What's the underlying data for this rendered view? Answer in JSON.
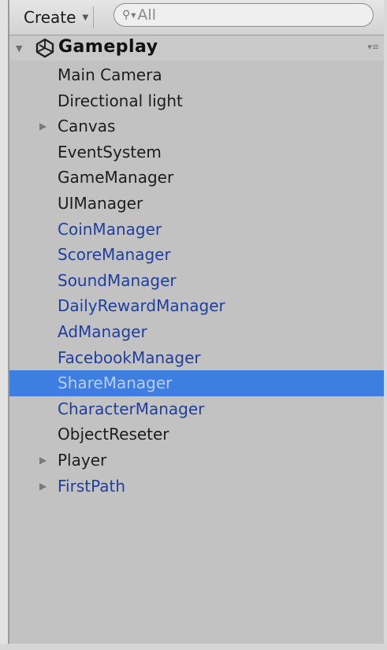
{
  "toolbar": {
    "create_label": "Create",
    "search_placeholder": "All"
  },
  "scene": {
    "name": "Gameplay"
  },
  "hierarchy": [
    {
      "label": "Main Camera",
      "prefab": false,
      "expandable": false,
      "selected": false
    },
    {
      "label": "Directional light",
      "prefab": false,
      "expandable": false,
      "selected": false
    },
    {
      "label": "Canvas",
      "prefab": false,
      "expandable": true,
      "selected": false
    },
    {
      "label": "EventSystem",
      "prefab": false,
      "expandable": false,
      "selected": false
    },
    {
      "label": "GameManager",
      "prefab": false,
      "expandable": false,
      "selected": false
    },
    {
      "label": "UIManager",
      "prefab": false,
      "expandable": false,
      "selected": false
    },
    {
      "label": "CoinManager",
      "prefab": true,
      "expandable": false,
      "selected": false
    },
    {
      "label": "ScoreManager",
      "prefab": true,
      "expandable": false,
      "selected": false
    },
    {
      "label": "SoundManager",
      "prefab": true,
      "expandable": false,
      "selected": false
    },
    {
      "label": "DailyRewardManager",
      "prefab": true,
      "expandable": false,
      "selected": false
    },
    {
      "label": "AdManager",
      "prefab": true,
      "expandable": false,
      "selected": false
    },
    {
      "label": "FacebookManager",
      "prefab": true,
      "expandable": false,
      "selected": false
    },
    {
      "label": "ShareManager",
      "prefab": true,
      "expandable": false,
      "selected": true
    },
    {
      "label": "CharacterManager",
      "prefab": true,
      "expandable": false,
      "selected": false
    },
    {
      "label": "ObjectReseter",
      "prefab": false,
      "expandable": false,
      "selected": false
    },
    {
      "label": "Player",
      "prefab": false,
      "expandable": true,
      "selected": false
    },
    {
      "label": "FirstPath",
      "prefab": true,
      "expandable": true,
      "selected": false
    }
  ],
  "icons": {
    "create_caret": "chevron-down-icon",
    "search": "search-icon",
    "scene_fold": "triangle-down-icon",
    "scene": "unity-scene-icon",
    "scene_menu": "menu-icon",
    "expander": "triangle-right-icon"
  },
  "colors": {
    "selection": "#3d7fe0",
    "prefab_text": "#1f3f9f",
    "normal_text": "#1d1d1d"
  }
}
